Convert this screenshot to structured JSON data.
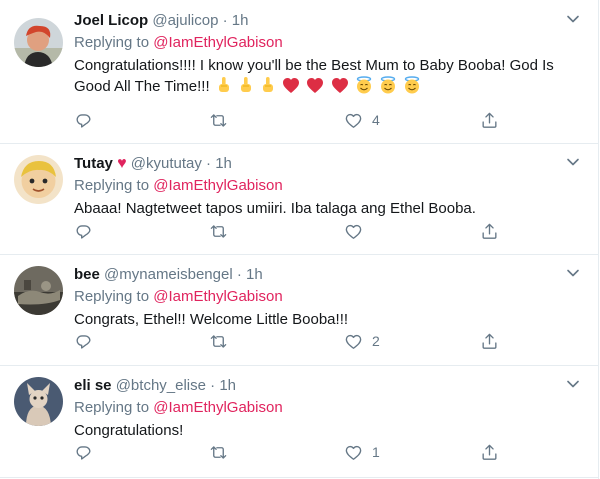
{
  "replying_label": "Replying to",
  "tweets": [
    {
      "name": "Joel Licop",
      "handle": "@ajulicop",
      "separator": "·",
      "time": "1h",
      "mention": "@IamEthylGabison",
      "text": "Congratulations!!!! I know you'll be the Best Mum to Baby Booba! God Is Good All The Time!!!",
      "emoji": [
        "pointing-up-hand",
        "pointing-up-hand",
        "pointing-up-hand",
        "red-heart",
        "red-heart",
        "red-heart",
        "smiling-halo-face",
        "smiling-halo-face",
        "smiling-halo-face"
      ],
      "likes": "4"
    },
    {
      "name": "Tutay",
      "name_emoji": "♥",
      "handle": "@kyututay",
      "separator": "·",
      "time": "1h",
      "mention": "@IamEthylGabison",
      "text": "Abaaa! Nagtetweet tapos umiiri. Iba talaga ang Ethel Booba.",
      "likes": ""
    },
    {
      "name": "bee",
      "handle": "@mynameisbengel",
      "separator": "·",
      "time": "1h",
      "mention": "@IamEthylGabison",
      "text": "Congrats, Ethel!! Welcome Little Booba!!!",
      "likes": "2"
    },
    {
      "name": "eli se",
      "handle": "@btchy_elise",
      "separator": "·",
      "time": "1h",
      "mention": "@IamEthylGabison",
      "text": "Congratulations!",
      "likes": "1"
    }
  ],
  "colors": {
    "accent_mention": "#e0245e",
    "muted": "#657786",
    "icon": "#657786",
    "divider": "#e6ecf0"
  }
}
